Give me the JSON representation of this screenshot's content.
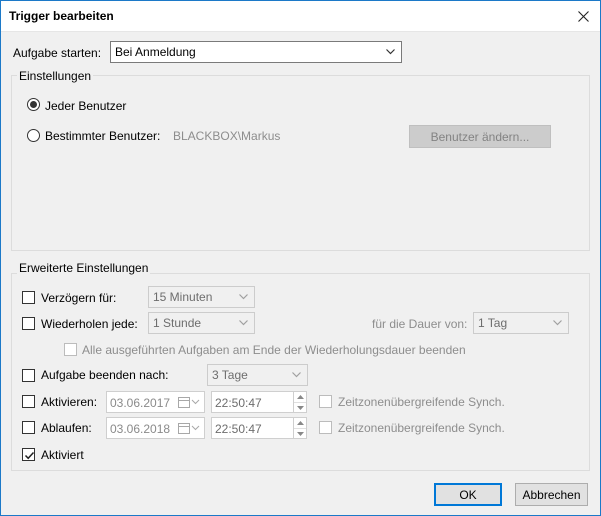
{
  "window": {
    "title": "Trigger bearbeiten"
  },
  "start": {
    "label": "Aufgabe starten:",
    "value": "Bei Anmeldung"
  },
  "settings": {
    "title": "Einstellungen",
    "any_user": "Jeder Benutzer",
    "specific_user": "Bestimmter Benutzer:",
    "user_name": "BLACKBOX\\Markus",
    "change_user_button": "Benutzer ändern..."
  },
  "advanced": {
    "title": "Erweiterte Einstellungen",
    "delay_label": "Verzögern für:",
    "delay_value": "15 Minuten",
    "repeat_label": "Wiederholen jede:",
    "repeat_value": "1 Stunde",
    "duration_label": "für die Dauer von:",
    "duration_value": "1 Tag",
    "stop_all_label": "Alle ausgeführten Aufgaben am Ende der Wiederholungsdauer beenden",
    "stop_after_label": "Aufgabe beenden nach:",
    "stop_after_value": "3 Tage",
    "activate_label": "Aktivieren:",
    "activate_date": "03.06.2017",
    "activate_time": "22:50:47",
    "activate_sync": "Zeitzonenübergreifende Synch.",
    "expire_label": "Ablaufen:",
    "expire_date": "03.06.2018",
    "expire_time": "22:50:47",
    "expire_sync": "Zeitzonenübergreifende Synch.",
    "enabled_label": "Aktiviert"
  },
  "buttons": {
    "ok": "OK",
    "cancel": "Abbrechen"
  },
  "colors": {
    "accent": "#0078d7",
    "border": "#1c79c8",
    "face": "#f0f0f0"
  }
}
